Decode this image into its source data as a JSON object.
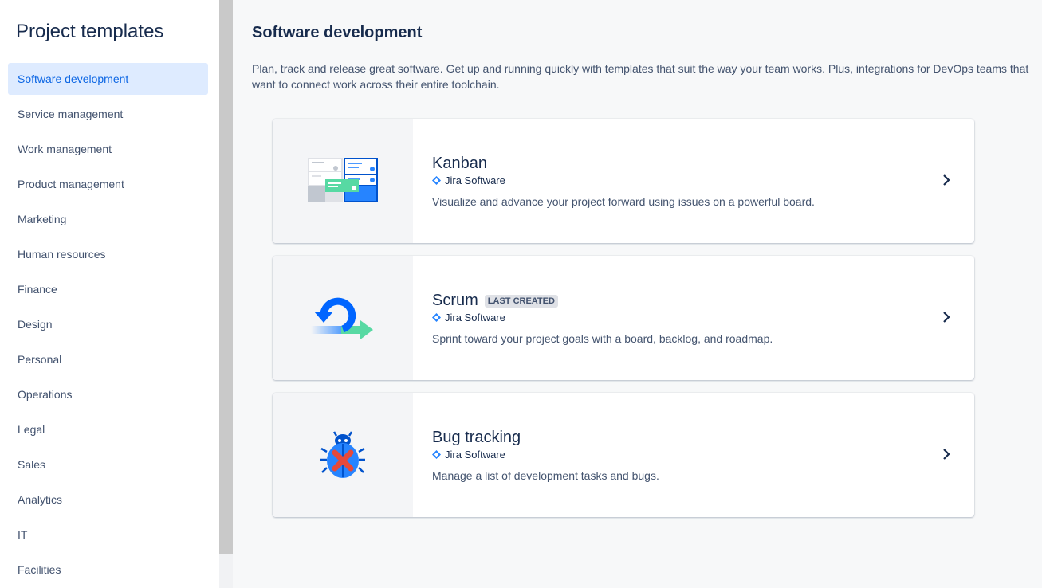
{
  "sidebar": {
    "title": "Project templates",
    "items": [
      {
        "label": "Software development"
      },
      {
        "label": "Service management"
      },
      {
        "label": "Work management"
      },
      {
        "label": "Product management"
      },
      {
        "label": "Marketing"
      },
      {
        "label": "Human resources"
      },
      {
        "label": "Finance"
      },
      {
        "label": "Design"
      },
      {
        "label": "Personal"
      },
      {
        "label": "Operations"
      },
      {
        "label": "Legal"
      },
      {
        "label": "Sales"
      },
      {
        "label": "Analytics"
      },
      {
        "label": "IT"
      },
      {
        "label": "Facilities"
      }
    ],
    "selected_index": 0
  },
  "main": {
    "title": "Software development",
    "description": "Plan, track and release great software. Get up and running quickly with templates that suit the way your team works. Plus, integrations for DevOps teams that want to connect work across their entire toolchain.",
    "cards": [
      {
        "title": "Kanban",
        "badge": "",
        "product": "Jira Software",
        "description": "Visualize and advance your project forward using issues on a powerful board.",
        "icon": "kanban-board-icon"
      },
      {
        "title": "Scrum",
        "badge": "Last created",
        "product": "Jira Software",
        "description": "Sprint toward your project goals with a board, backlog, and roadmap.",
        "icon": "scrum-cycle-icon"
      },
      {
        "title": "Bug tracking",
        "badge": "",
        "product": "Jira Software",
        "description": "Manage a list of development tasks and bugs.",
        "icon": "bug-icon"
      }
    ]
  },
  "colors": {
    "selected_bg": "#deebff",
    "selected_text": "#0c66e4",
    "jira_blue": "#2684ff",
    "scrum_green": "#57d9a3"
  }
}
